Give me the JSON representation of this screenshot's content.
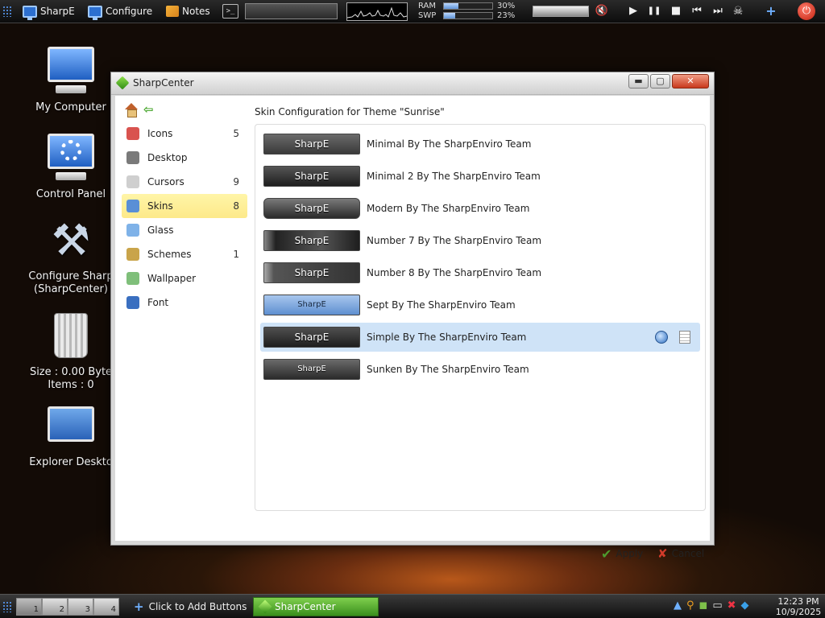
{
  "topbar": {
    "sharpe_label": "SharpE",
    "configure_label": "Configure",
    "notes_label": "Notes",
    "terminal_glyph": ">_",
    "ram_label": "RAM",
    "swp_label": "SWP",
    "ram_pct": "30%",
    "swp_pct": "23%",
    "ram_fraction": 0.3,
    "swp_fraction": 0.23,
    "media": {
      "play": "▶",
      "pause": "❚❚",
      "stop": "■",
      "prev": "⏮",
      "next": "⏭"
    },
    "add_glyph": "+",
    "power_glyph": "⏻",
    "icons": [
      "grid-icon",
      "monitor-icon",
      "notes-icon",
      "terminal-icon",
      "cpu-graph",
      "speaker-muted-icon",
      "media-player-icon",
      "power-icon"
    ]
  },
  "desktop": {
    "icons": [
      {
        "label": "My Computer"
      },
      {
        "label": "Control Panel"
      },
      {
        "label": "Configure Sharp",
        "label2": "(SharpCenter)"
      },
      {
        "label": "Size : 0.00 Byte",
        "label2": "Items : 0"
      },
      {
        "label": "Explorer Deskto"
      }
    ]
  },
  "window": {
    "title": "SharpCenter",
    "buttons": {
      "minimize": "▬",
      "maximize": "▢",
      "close": "✕"
    },
    "heading": "Skin Configuration for Theme \"Sunrise\"",
    "sidebar": [
      {
        "label": "Icons",
        "count": "5",
        "icon": "icons-icon",
        "color": "#d9534f"
      },
      {
        "label": "Desktop",
        "count": "",
        "icon": "desktop-icon",
        "color": "#7a7a7a"
      },
      {
        "label": "Cursors",
        "count": "9",
        "icon": "cursor-icon",
        "color": "#cfcfcf"
      },
      {
        "label": "Skins",
        "count": "8",
        "icon": "skins-icon",
        "color": "#5a8fd6"
      },
      {
        "label": "Glass",
        "count": "",
        "icon": "glass-icon",
        "color": "#7fb2e8"
      },
      {
        "label": "Schemes",
        "count": "1",
        "icon": "brush-icon",
        "color": "#c9a44a"
      },
      {
        "label": "Wallpaper",
        "count": "",
        "icon": "wallpaper-icon",
        "color": "#7fbf7a"
      },
      {
        "label": "Font",
        "count": "",
        "icon": "font-icon",
        "color": "#3a6fc0"
      }
    ],
    "skins": [
      {
        "preview": "SharpE",
        "name": "Minimal By The SharpEnviro Team",
        "style": "minimal"
      },
      {
        "preview": "SharpE",
        "name": "Minimal 2 By The SharpEnviro Team",
        "style": "minimal2"
      },
      {
        "preview": "SharpE",
        "name": "Modern By The SharpEnviro Team",
        "style": "modern"
      },
      {
        "preview": "SharpE",
        "name": "Number 7 By The SharpEnviro Team",
        "style": "number7"
      },
      {
        "preview": "SharpE",
        "name": "Number 8 By The SharpEnviro Team",
        "style": "number8"
      },
      {
        "preview": "SharpE",
        "name": "Sept By The SharpEnviro Team",
        "style": "sept"
      },
      {
        "preview": "SharpE",
        "name": "Simple By The SharpEnviro Team",
        "style": "simple",
        "selected": true
      },
      {
        "preview": "SharpE",
        "name": "Sunken By The SharpEnviro Team",
        "style": "sunken"
      }
    ],
    "apply_label": "Apply",
    "cancel_label": "Cancel",
    "colors": {
      "selected_row": "#cfe3f7",
      "active_sidebar": "#fde98a"
    }
  },
  "taskbar": {
    "desktops": [
      "1",
      "2",
      "3",
      "4"
    ],
    "add_buttons_label": "Click to Add Buttons",
    "task_label": "SharpCenter",
    "tray_icons": [
      "arrow-up-icon",
      "search-icon",
      "nvidia-icon",
      "network-icon",
      "volume-muted-icon",
      "bluetooth-icon"
    ],
    "clock_time": "12:23 PM",
    "clock_date": "10/9/2025"
  }
}
